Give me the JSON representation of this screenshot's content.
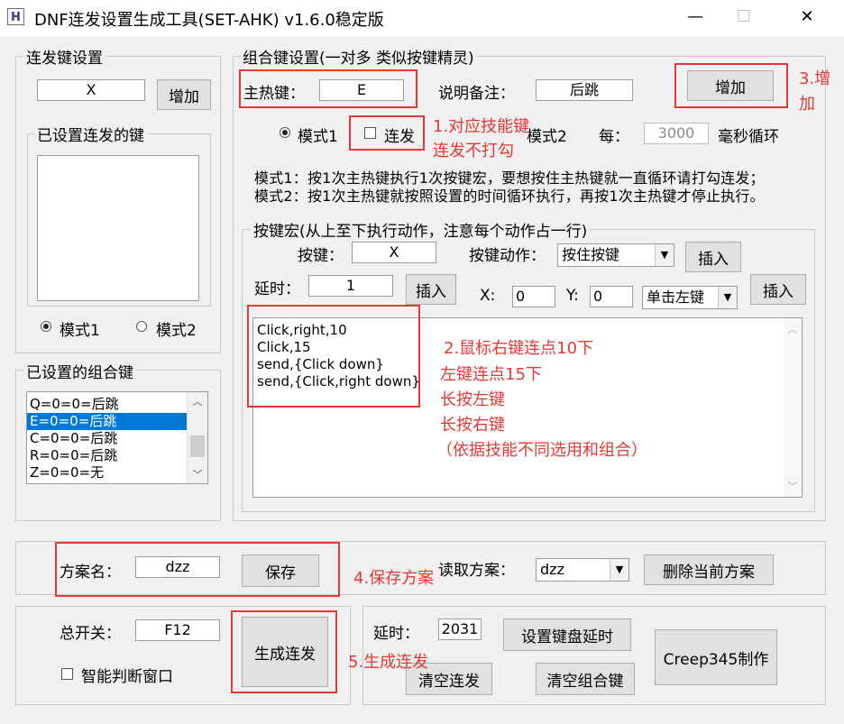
{
  "window": {
    "icon_letter": "H",
    "title": "DNF连发设置生成工具(SET-AHK) v1.6.0稳定版",
    "minimize_glyph": "—",
    "maximize_glyph": "☐",
    "close_glyph": "✕"
  },
  "rapid": {
    "group_title": "连发键设置",
    "key_value": "X",
    "add_label": "增加",
    "set_keys_title": "已设置连发的键",
    "mode1_label": "模式1",
    "mode2_label": "模式2"
  },
  "combo_list": {
    "title": "已设置的组合键",
    "items": [
      "Q=0=0=后跳",
      "E=0=0=后跳",
      "C=0=0=后跳",
      "R=0=0=后跳",
      "Z=0=0=无"
    ],
    "selected_index": 1
  },
  "combo": {
    "group_title": "组合键设置(一对多 类似按键精灵)",
    "hotkey_label": "主热键：",
    "hotkey_value": "E",
    "note_label": "说明备注：",
    "note_value": "后跳",
    "add_label": "增加",
    "mode1_label": "模式1",
    "repeat_label": "连发",
    "mode2_label": "模式2",
    "every_label": "每：",
    "interval_value": "3000",
    "interval_unit": "毫秒循环",
    "desc1": "模式1：按1次主热键执行1次按键宏，要想按住主热键就一直循环请打勾连发；",
    "desc2": "模式2：按1次主热键就按照设置的时间循环执行，再按1次主热键才停止执行。"
  },
  "macro": {
    "group_title": "按键宏(从上至下执行动作，注意每个动作占一行)",
    "key_label": "按键：",
    "key_value": "X",
    "action_label": "按键动作：",
    "action_value": "按住按键",
    "insert_label": "插入",
    "delay_label": "延时：",
    "delay_value": "1",
    "x_label": "X:",
    "x_value": "0",
    "y_label": "Y:",
    "y_value": "0",
    "mouse_value": "单击左键",
    "lines": [
      "Click,right,10",
      "Click,15",
      "send,{Click down}",
      "send,{Click,right down}"
    ]
  },
  "scheme": {
    "name_label": "方案名：",
    "name_value": "dzz",
    "save_label": "保存",
    "load_label": "读取方案：",
    "load_value": "dzz",
    "delete_label": "删除当前方案"
  },
  "bottom": {
    "master_label": "总开关：",
    "master_value": "F12",
    "smart_label": "智能判断窗口",
    "generate_label": "生成连发",
    "delay_label": "延时：",
    "delay_value": "2031",
    "set_delay_label": "设置键盘延时",
    "clear_rapid_label": "清空连发",
    "clear_combo_label": "清空组合键",
    "credit_label": "Creep345制作"
  },
  "annotations": {
    "a1_line1": "1.对应技能键",
    "a1_line2": "连发不打勾",
    "a2_line1": "2.鼠标右键连点10下",
    "a2_line2": "左键连点15下",
    "a2_line3": "长按左键",
    "a2_line4": "长按右键",
    "a2_line5": "（依据技能不同选用和组合）",
    "a3_line1": "3.增",
    "a3_line2": "加",
    "a4": "4.保存方案",
    "a5": "5.生成连发",
    "color": "#e53935"
  }
}
